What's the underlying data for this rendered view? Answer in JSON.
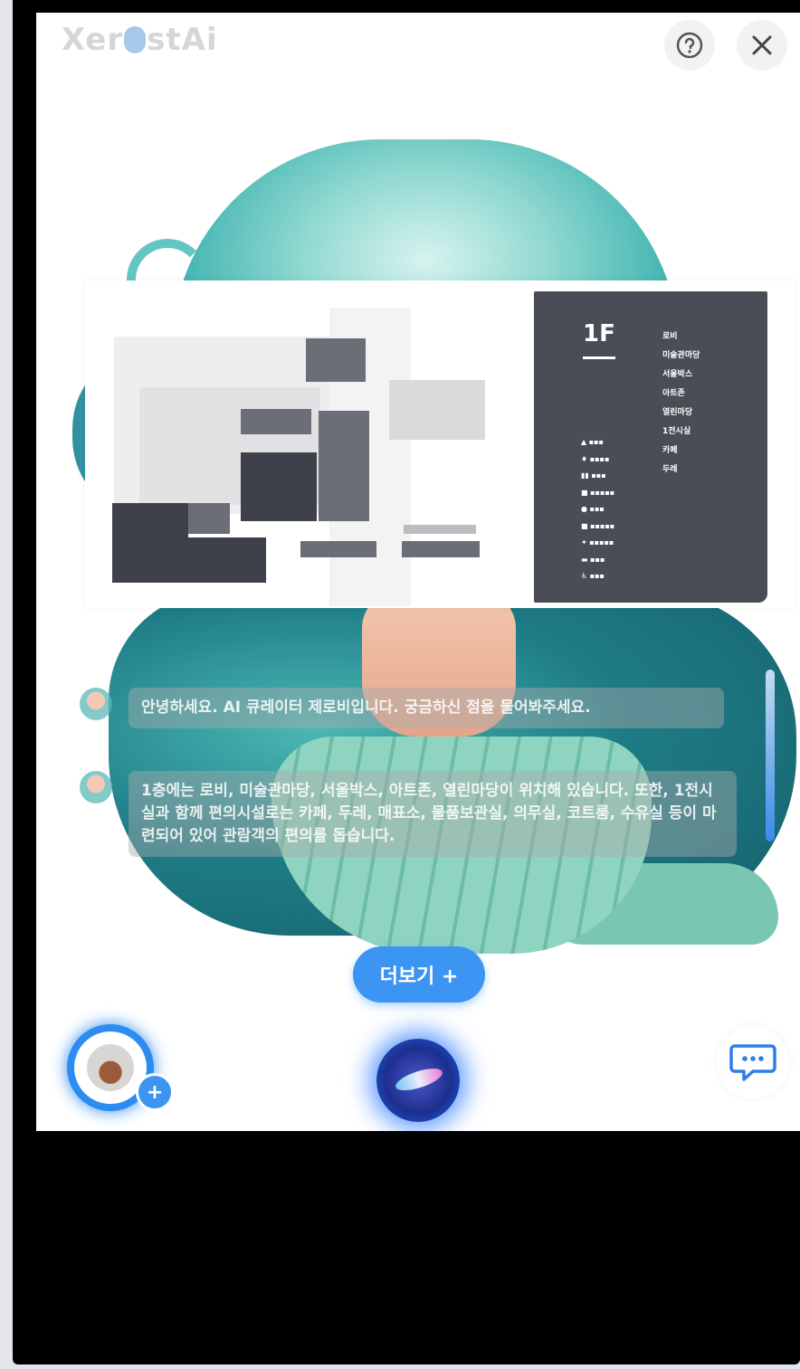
{
  "header": {
    "logo_prefix": "Xer",
    "logo_suffix": "stAi",
    "help_icon": "question-circle-icon",
    "close_icon": "close-icon"
  },
  "floor_map": {
    "floor_label": "1F",
    "facilities": [
      "로비",
      "미술관마당",
      "서울박스",
      "아트존",
      "열린마당",
      "1전시실",
      "카페",
      "두레"
    ]
  },
  "chat": {
    "messages": [
      {
        "role": "assistant",
        "text": "안녕하세요. AI 큐레이터 제로비입니다. 궁금하신 점을 물어봐주세요."
      },
      {
        "role": "assistant",
        "text": "1층에는 로비, 미술관마당, 서울박스, 아트존, 열린마당이 위치해 있습니다. 또한, 1전시실과 함께 편의시설로는 카페, 두레, 매표소, 물품보관실, 의무실, 코트룸, 수유실 등이 마련되어 있어 관람객의 편의를 돕습니다."
      }
    ]
  },
  "more_button": {
    "label": "더보기 +"
  },
  "bottom_bar": {
    "artifact_icon": "artifact-thumbnail",
    "plus_badge": "+",
    "voice_icon": "voice-orb-icon",
    "chat_icon": "chat-bubble-icon"
  },
  "colors": {
    "accent": "#3c95f2",
    "map_panel": "#4a4d55"
  }
}
